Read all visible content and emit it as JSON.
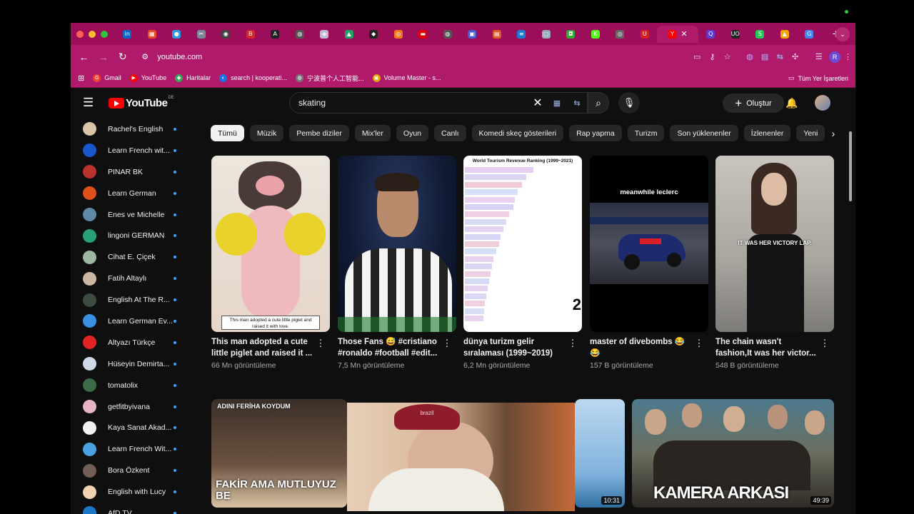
{
  "browser": {
    "url": "youtube.com",
    "new_tab": "+",
    "tab_menu": "⌄",
    "profile_initial": "R",
    "tabs": [
      {
        "icon": "in",
        "color": "#0a66c2"
      },
      {
        "icon": "▦",
        "color": "#e94b27"
      },
      {
        "icon": "●",
        "color": "#2d9cdb"
      },
      {
        "icon": "✂",
        "color": "#7b8794"
      },
      {
        "icon": "◉",
        "color": "#444"
      },
      {
        "icon": "B",
        "color": "#d9262b"
      },
      {
        "icon": "A",
        "color": "#222"
      },
      {
        "icon": "◍",
        "color": "#555"
      },
      {
        "icon": "◈",
        "color": "#c6b7d3"
      },
      {
        "icon": "▲",
        "color": "#1fa463"
      },
      {
        "icon": "◆",
        "color": "#222"
      },
      {
        "icon": "◎",
        "color": "#f4761b"
      },
      {
        "icon": "▬",
        "color": "#dd0000"
      },
      {
        "icon": "◍",
        "color": "#555"
      },
      {
        "icon": "▣",
        "color": "#4c5bd4"
      },
      {
        "icon": "▤",
        "color": "#e05a2b"
      },
      {
        "icon": "≡",
        "color": "#1b7ccf"
      },
      {
        "icon": "▢",
        "color": "#9ab"
      },
      {
        "icon": "◘",
        "color": "#33aa33"
      },
      {
        "icon": "K",
        "color": "#53fc18"
      },
      {
        "icon": "◎",
        "color": "#666"
      },
      {
        "icon": "U",
        "color": "#d91f26"
      }
    ],
    "active_tab_icon": "Y",
    "active_tab_close": "✕",
    "tabs_after": [
      {
        "icon": "Q",
        "color": "#5b3cd6"
      },
      {
        "icon": "UO",
        "color": "#222"
      },
      {
        "icon": "S",
        "color": "#25c75b"
      },
      {
        "icon": "▲",
        "color": "#f2a900"
      },
      {
        "icon": "G",
        "color": "#4285f4"
      }
    ]
  },
  "bookmarks": {
    "items": [
      {
        "label": "Gmail",
        "color": "#ea4335",
        "icon": "G"
      },
      {
        "label": "YouTube",
        "color": "#ff0000",
        "icon": "▶"
      },
      {
        "label": "Haritalar",
        "color": "#34a853",
        "icon": "◆"
      },
      {
        "label": "search | kooperati...",
        "color": "#1a73e8",
        "icon": "◐"
      },
      {
        "label": "宁波普个人工智能...",
        "color": "#777",
        "icon": "◍"
      },
      {
        "label": "Volume Master - s...",
        "color": "#e2a100",
        "icon": "▣"
      }
    ],
    "all_label": "Tüm Yer İşaretleri"
  },
  "youtube": {
    "logo_text": "YouTube",
    "country_code": "DE",
    "search_query": "skating",
    "create_label": "Oluştur",
    "subscriptions": [
      {
        "name": "Rachel's English",
        "color": "#d9c4a8"
      },
      {
        "name": "Learn French wit...",
        "color": "#1a56c9"
      },
      {
        "name": "PINAR BK",
        "color": "#b8322e"
      },
      {
        "name": "Learn German",
        "color": "#e0501b"
      },
      {
        "name": "Enes ve Michelle",
        "color": "#5e8aa8"
      },
      {
        "name": "lingoni GERMAN",
        "color": "#27a07a"
      },
      {
        "name": "Cihat E. Çiçek",
        "color": "#9bb7a0"
      },
      {
        "name": "Fatih Altaylı",
        "color": "#cbb7a2"
      },
      {
        "name": "English At The R...",
        "color": "#3d4a3f"
      },
      {
        "name": "Learn German Ev...",
        "color": "#3a8fe0"
      },
      {
        "name": "Altyazı Türkçe",
        "color": "#e22424"
      },
      {
        "name": "Hüseyin Demirta...",
        "color": "#cfd8e6"
      },
      {
        "name": "tomatolix",
        "color": "#3b6b48"
      },
      {
        "name": "getfitbyivana",
        "color": "#e7b3c6"
      },
      {
        "name": "Kaya Sanat Akad...",
        "color": "#f1f1f1"
      },
      {
        "name": "Learn French Wit...",
        "color": "#4aa1e0"
      },
      {
        "name": "Bora Özkent",
        "color": "#6f5f55"
      },
      {
        "name": "English with Lucy",
        "color": "#f0d2b0"
      },
      {
        "name": "AfD TV",
        "color": "#1b78c9"
      }
    ],
    "chips": [
      "Tümü",
      "Müzik",
      "Pembe diziler",
      "Mix'ler",
      "Oyun",
      "Canlı",
      "Komedi skeç gösterileri",
      "Rap yapma",
      "Turizm",
      "Son yüklenenler",
      "İzlenenler",
      "Yeni"
    ],
    "shorts": [
      {
        "title": "This man adopted a cute little piglet and raised it ...",
        "views": "66 Mn görüntüleme",
        "caption": "This man adopted a cute little piglet and raised it with love."
      },
      {
        "title": "Those Fans 😅 #cristiano #ronaldo #football #edit...",
        "views": "7,5 Mn görüntüleme"
      },
      {
        "title": "dünya turizm gelir sıralaması (1999~2019)",
        "views": "6,2 Mn görüntüleme",
        "chart_title": "World Tourism Revenue Ranking (1999~2021)",
        "rank_number": "2"
      },
      {
        "title": "master of divebombs 😂 😂",
        "views": "157 B görüntüleme",
        "caption": "meanwhile leclerc"
      },
      {
        "title": "The chain wasn't fashion,It was her victor...",
        "views": "548 B görüntüleme",
        "caption": "IT WAS HER VICTORY LAP."
      }
    ],
    "videos": [
      {
        "overlay": "FAKİR AMA MUTLUYUZ BE",
        "top_caption": "ADINI FERİHA KOYDUM"
      },
      {
        "hat_text": "brazil"
      },
      {
        "duration": "10:31"
      },
      {
        "overlay": "KAMERA ARKASI",
        "duration": "49:39"
      }
    ]
  }
}
